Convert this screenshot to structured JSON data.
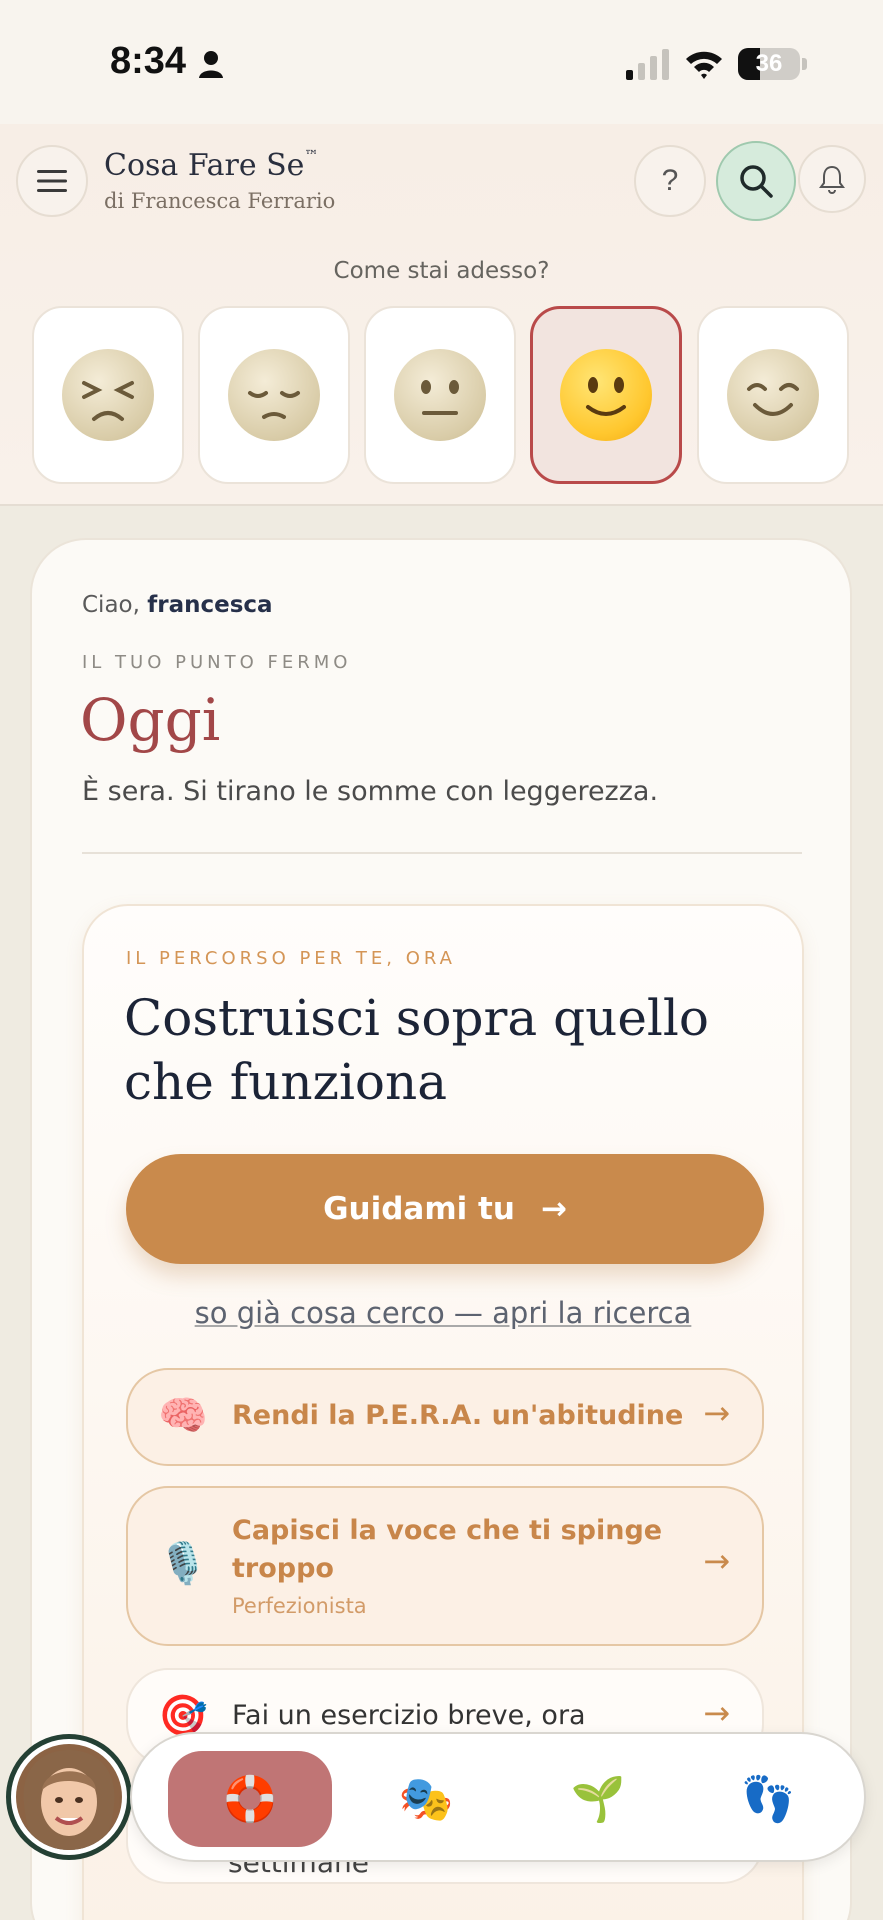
{
  "status_bar": {
    "time": "8:34",
    "battery_percent": 36,
    "battery_label": "36"
  },
  "header": {
    "brand_title": "Cosa Fare Se",
    "brand_tm": "™",
    "brand_subtitle": "di Francesca Ferrario",
    "help_label": "?",
    "icons": [
      "menu-icon",
      "help-icon",
      "search-icon",
      "bell-icon"
    ]
  },
  "mood": {
    "question": "Come stai adesso?",
    "options": [
      {
        "emoji": "😣",
        "selected": false
      },
      {
        "emoji": "😔",
        "selected": false
      },
      {
        "emoji": "😐",
        "selected": false
      },
      {
        "emoji": "🙂",
        "selected": true
      },
      {
        "emoji": "😊",
        "selected": false
      }
    ]
  },
  "main": {
    "greeting_prefix": "Ciao, ",
    "user_name": "francesca",
    "kicker": "IL TUO PUNTO FERMO",
    "title": "Oggi",
    "tagline": "È sera. Si tirano le somme con leggerezza."
  },
  "path": {
    "kicker": "IL PERCORSO PER TE, ORA",
    "title": "Costruisci sopra quello che funziona",
    "cta_label": "Guidami tu",
    "cta_arrow": "→",
    "search_link": "so già cosa cerco — apri la ricerca",
    "options": [
      {
        "icon": "🧠",
        "label": "Rendi la P.E.R.A. un'abitudine",
        "sub": "",
        "arrow": "→"
      },
      {
        "icon": "🎙️",
        "label": "Capisci la voce che ti spinge troppo",
        "sub": "Perfezionista",
        "arrow": "→"
      },
      {
        "icon": "🎯",
        "label": "Fai un esercizio breve, ora",
        "sub": "",
        "arrow": "→"
      },
      {
        "label": "settimane"
      }
    ]
  },
  "bottom_nav": {
    "items": [
      {
        "icon": "🛟",
        "name": "lifebuoy",
        "active": true
      },
      {
        "icon": "🎭",
        "name": "theater-masks",
        "active": false
      },
      {
        "icon": "🌱",
        "name": "seedling",
        "active": false
      },
      {
        "icon": "👣",
        "name": "footprints",
        "active": false
      }
    ]
  },
  "colors": {
    "accent": "#c98a4c",
    "title_red": "#a24748",
    "search_bg": "#d6ebdc",
    "nav_active": "#c07575",
    "selected_mood_border": "#b94a4a"
  }
}
